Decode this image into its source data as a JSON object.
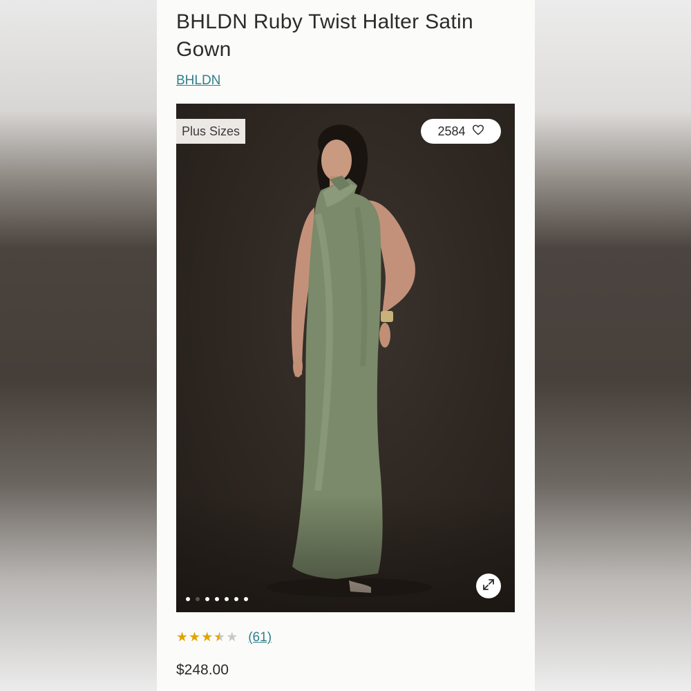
{
  "product": {
    "title": "BHLDN Ruby Twist Halter Satin Gown",
    "brand": "BHLDN",
    "price": "$248.00"
  },
  "gallery": {
    "badge": "Plus Sizes",
    "likes": "2584",
    "image_alt": "Model wearing a sage green satin halter gown",
    "slide_count": 7,
    "active_slide": 1
  },
  "rating": {
    "value": 3.5,
    "max": 5,
    "count_label": "(61)"
  },
  "colors": {
    "link": "#2f7f8c",
    "star": "#e0a400",
    "gown": "#7a8a6a"
  }
}
